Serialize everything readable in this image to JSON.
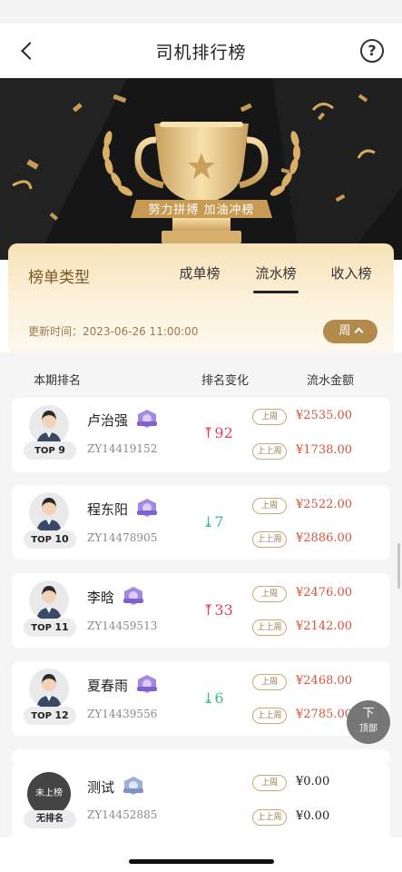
{
  "nav": {
    "title": "司机排行榜",
    "help": "?"
  },
  "hero": {
    "banner_text": "努力拼搏 加油冲榜"
  },
  "board": {
    "label": "榜单类型",
    "tabs": [
      "成单榜",
      "流水榜",
      "收入榜"
    ],
    "active_tab": "流水榜",
    "update_time": "更新时间：2023-06-26 11:00:00",
    "period_button": "周"
  },
  "columns": {
    "rank": "本期排名",
    "change": "排名变化",
    "amount": "流水金额"
  },
  "tags": {
    "last_week": "上周",
    "week_before": "上上周"
  },
  "rows": [
    {
      "rank_prefix": "TOP",
      "rank": "9",
      "name": "卢治强",
      "id": "ZY14419152",
      "change": "92",
      "direction": "up",
      "last_week": "¥2535.00",
      "week_before": "¥1738.00"
    },
    {
      "rank_prefix": "TOP",
      "rank": "10",
      "name": "程东阳",
      "id": "ZY14478905",
      "change": "7",
      "direction": "down",
      "last_week": "¥2522.00",
      "week_before": "¥2886.00"
    },
    {
      "rank_prefix": "TOP",
      "rank": "11",
      "name": "李晗",
      "id": "ZY14459513",
      "change": "33",
      "direction": "up",
      "last_week": "¥2476.00",
      "week_before": "¥2142.00"
    },
    {
      "rank_prefix": "TOP",
      "rank": "12",
      "name": "夏春雨",
      "id": "ZY14439556",
      "change": "6",
      "direction": "down",
      "last_week": "¥2468.00",
      "week_before": "¥2785.00"
    }
  ],
  "mine": {
    "avatar_label": "未上榜",
    "rank_label": "无排名",
    "name": "测试",
    "id": "ZY14452885",
    "last_week": "¥0.00",
    "week_before": "¥0.00"
  },
  "back_to_top": {
    "arrow": "下",
    "label": "顶部"
  },
  "colors": {
    "gold": "#b18a4c",
    "up": "#e0405c",
    "down": "#3dbb7a",
    "amount": "#d9533f"
  },
  "icons": [
    "back-icon",
    "help-icon",
    "trophy-icon",
    "medal-icon",
    "arrow-up-icon",
    "arrow-down-icon",
    "chevron-up-icon"
  ]
}
